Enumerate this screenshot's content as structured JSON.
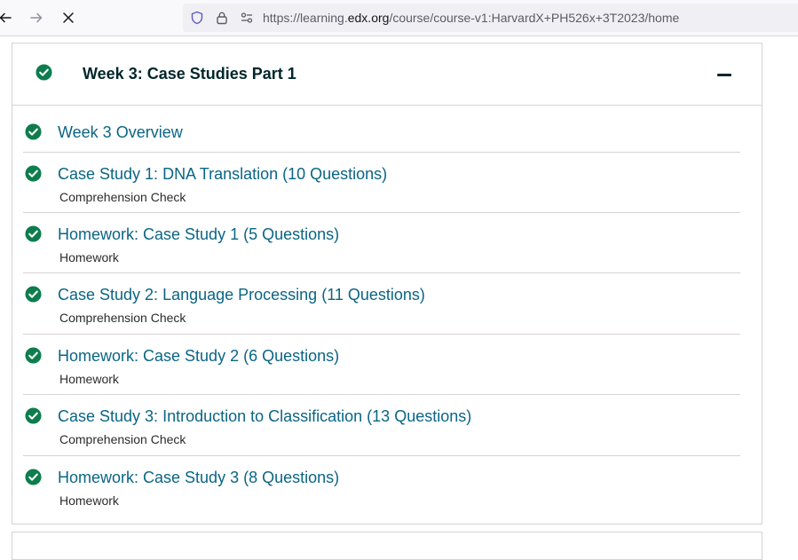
{
  "browser": {
    "url_prefix": "https://learning.",
    "url_host": "edx.org",
    "url_path": "/course/course-v1:HarvardX+PH526x+3T2023/home"
  },
  "section": {
    "title": "Week 3: Case Studies Part 1",
    "completed": true
  },
  "units": [
    {
      "title": "Week 3 Overview",
      "subtitle": "",
      "completed": true
    },
    {
      "title": "Case Study 1: DNA Translation (10 Questions)",
      "subtitle": "Comprehension Check",
      "completed": true
    },
    {
      "title": "Homework: Case Study 1 (5 Questions)",
      "subtitle": "Homework",
      "completed": true
    },
    {
      "title": "Case Study 2: Language Processing (11 Questions)",
      "subtitle": "Comprehension Check",
      "completed": true
    },
    {
      "title": "Homework: Case Study 2 (6 Questions)",
      "subtitle": "Homework",
      "completed": true
    },
    {
      "title": "Case Study 3: Introduction to Classification (13 Questions)",
      "subtitle": "Comprehension Check",
      "completed": true
    },
    {
      "title": "Homework: Case Study 3 (8 Questions)",
      "subtitle": "Homework",
      "completed": true
    }
  ],
  "colors": {
    "check": "#0d7d4d",
    "link": "#0a6585",
    "heading": "#00262b"
  }
}
